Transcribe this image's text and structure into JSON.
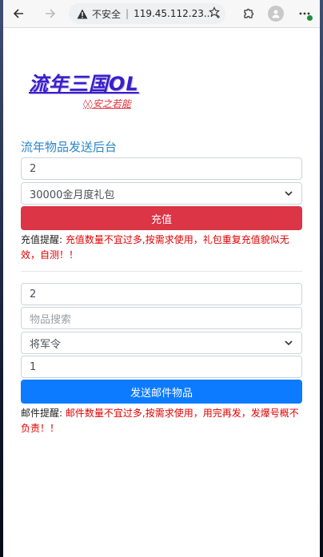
{
  "browser": {
    "insecure_label": "不安全",
    "url": "119.45.112.23...",
    "accent": "#1e8e3e"
  },
  "page": {
    "brand": "流年三国OL",
    "subtitle": "◊◊安之若能",
    "section_title": "流年物品发送后台"
  },
  "recharge": {
    "account_value": "2",
    "package_selected": "30000金月度礼包",
    "button_label": "充值",
    "notice_label": "充值提醒:",
    "notice_text": "充值数量不宜过多,按需求使用，礼包重复充值貌似无效，自测！！"
  },
  "mail": {
    "account_value": "2",
    "search_placeholder": "物品搜索",
    "item_selected": "将军令",
    "quantity_value": "1",
    "button_label": "发送邮件物品",
    "notice_label": "邮件提醒:",
    "notice_text": "邮件数量不宜过多,按需求使用，用完再发，发爆号概不负责！！"
  }
}
